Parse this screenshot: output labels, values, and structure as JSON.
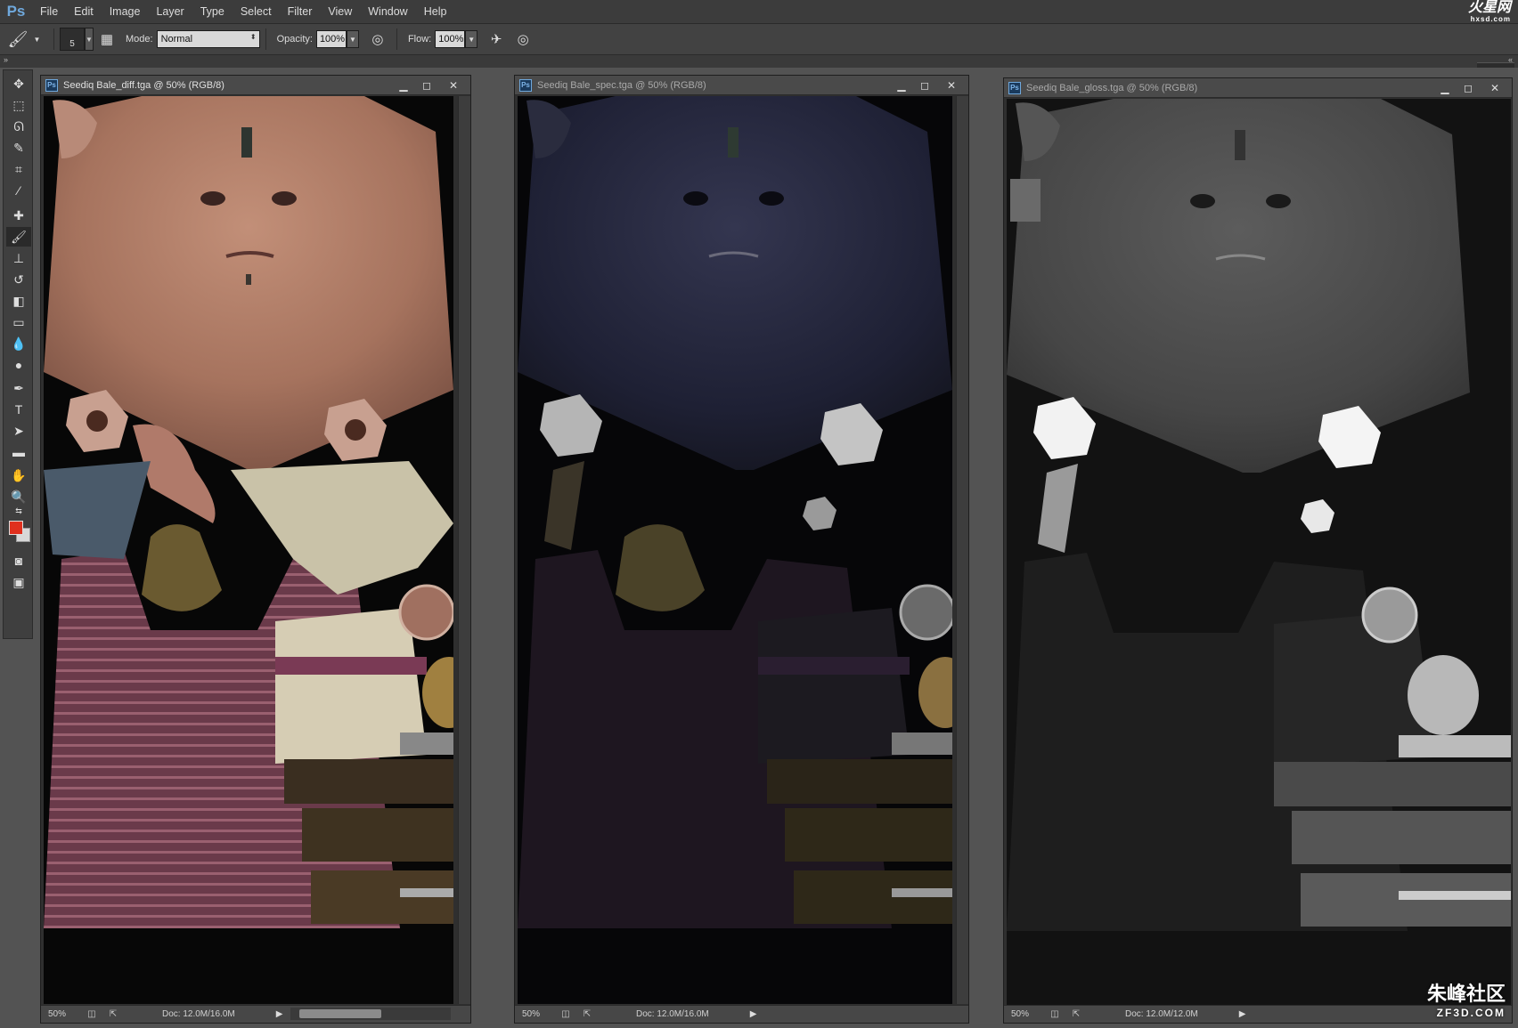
{
  "app": {
    "logo": "Ps",
    "menu": [
      "File",
      "Edit",
      "Image",
      "Layer",
      "Type",
      "Select",
      "Filter",
      "View",
      "Window",
      "Help"
    ],
    "watermark_top": "火星网",
    "watermark_top_sub": "hxsd.com",
    "watermark_bottom": "朱峰社区",
    "watermark_bottom_sub": "ZF3D.COM"
  },
  "options": {
    "brush_size": "5",
    "mode_label": "Mode:",
    "mode_value": "Normal",
    "opacity_label": "Opacity:",
    "opacity_value": "100%",
    "flow_label": "Flow:",
    "flow_value": "100%"
  },
  "documents": [
    {
      "title": "Seediq Bale_diff.tga @ 50% (RGB/8)",
      "zoom": "50%",
      "doc_info": "Doc: 12.0M/16.0M",
      "active": true
    },
    {
      "title": "Seediq Bale_spec.tga @ 50% (RGB/8)",
      "zoom": "50%",
      "doc_info": "Doc: 12.0M/16.0M",
      "active": false
    },
    {
      "title": "Seediq Bale_gloss.tga @ 50% (RGB/8)",
      "zoom": "50%",
      "doc_info": "Doc: 12.0M/12.0M",
      "active": false
    }
  ],
  "colors": {
    "foreground": "#e0301e",
    "background": "#d8d8d8"
  }
}
